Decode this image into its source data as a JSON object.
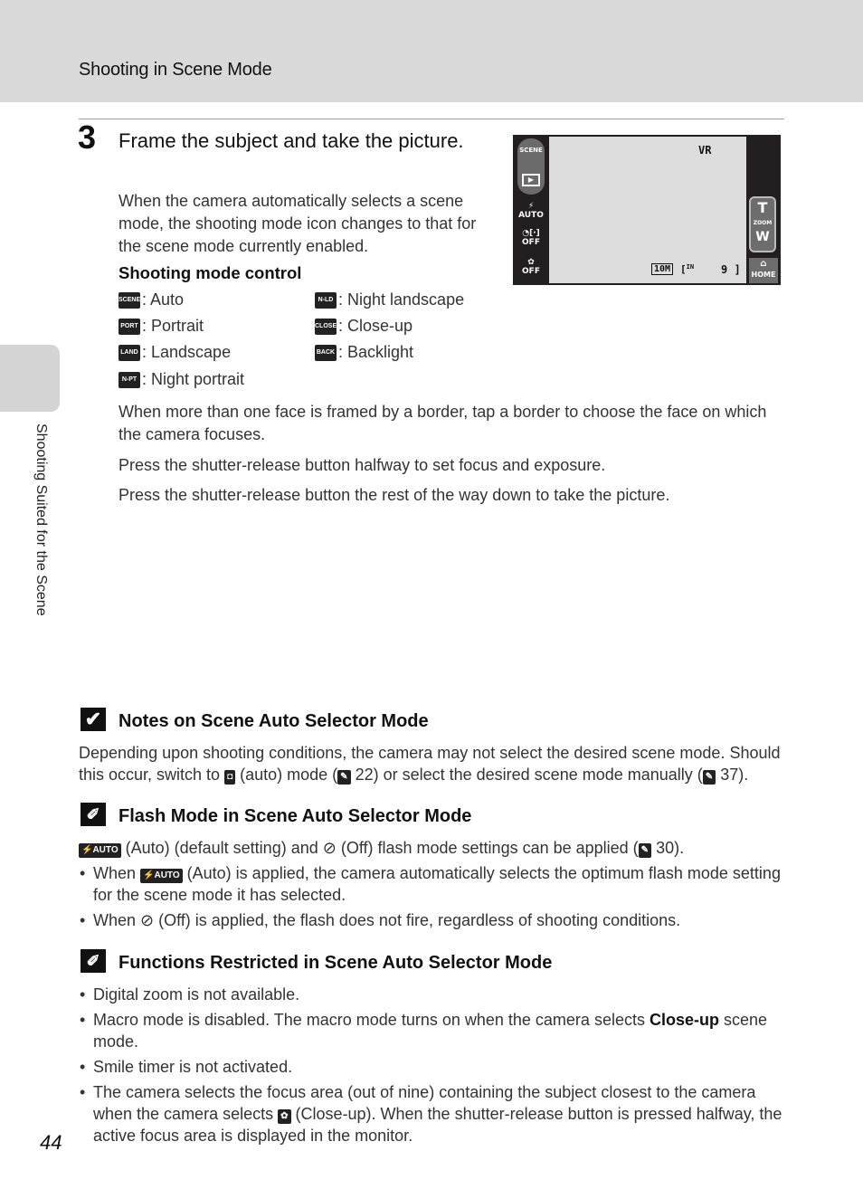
{
  "header": {
    "title": "Shooting in Scene Mode"
  },
  "side_tab": {
    "label": "Shooting Suited for the Scene"
  },
  "step": {
    "number": "3",
    "title": "Frame the subject and take the picture.",
    "intro": "When the camera automatically selects a scene mode, the shooting mode icon changes to that for the scene mode currently enabled.",
    "mode_control_title": "Shooting mode control",
    "modes": [
      {
        "icon": "SCENE",
        "label": ": Auto"
      },
      {
        "icon": "PORT",
        "label": ": Portrait"
      },
      {
        "icon": "LAND",
        "label": ": Landscape"
      },
      {
        "icon": "N-PT",
        "label": ": Night portrait"
      },
      {
        "icon": "N-LD",
        "label": ": Night landscape"
      },
      {
        "icon": "CLOSE",
        "label": ": Close-up"
      },
      {
        "icon": "BACK",
        "label": ": Backlight"
      }
    ],
    "para_faces": "When more than one face is framed by a border, tap a border to choose the face on which the camera focuses.",
    "para_halfway": "Press the shutter-release button halfway to set focus and exposure.",
    "para_full": "Press the shutter-release button the rest of the way down to take the picture."
  },
  "camera_screen": {
    "left_icons": [
      "SCENE",
      "▶",
      "AUTO",
      "OFF",
      "OFF"
    ],
    "vr_label": "VR",
    "zoom_t": "T",
    "zoom_label": "ZOOM",
    "zoom_w": "W",
    "home_label": "HOME",
    "image_size": "10M",
    "memory": "IN",
    "exposures_remaining": "9"
  },
  "notes": [
    {
      "title": "Notes on Scene Auto Selector Mode",
      "icon": "check-icon",
      "text_a": "Depending upon shooting conditions, the camera may not select the desired scene mode. Should this occur, switch to ",
      "text_b": " (auto) mode (",
      "ref1": "22",
      "text_c": ") or select the desired scene mode manually (",
      "ref2": "37",
      "text_d": ")."
    },
    {
      "title": "Flash Mode in Scene Auto Selector Mode",
      "icon": "pencil-icon",
      "flash_auto": "⚡AUTO",
      "flash_off": "⊘",
      "line_a": " (Auto) (default setting) and ",
      "line_b": " (Off) flash mode settings can be applied (",
      "ref": "30",
      "line_c": ").",
      "bullets": [
        {
          "pre": "When ",
          "post": " (Auto) is applied, the camera automatically selects the optimum flash mode setting for the scene mode it has selected."
        },
        {
          "pre": "When ",
          "post": " (Off) is applied, the flash does not fire, regardless of shooting conditions."
        }
      ]
    },
    {
      "title": "Functions Restricted in Scene Auto Selector Mode",
      "icon": "pencil-icon",
      "bullets": [
        "Digital zoom is not available.",
        "Macro mode is disabled. The macro mode turns on when the camera selects ",
        "Smile timer is not activated.",
        "The camera selects the focus area (out of nine) containing the subject closest to the camera when the camera selects "
      ],
      "closeup_bold": "Close-up",
      "macro_tail": " scene mode.",
      "focus_tail": " (Close-up). When the shutter-release button is pressed halfway, the active focus area is displayed in the monitor."
    }
  ],
  "page_number": "44"
}
